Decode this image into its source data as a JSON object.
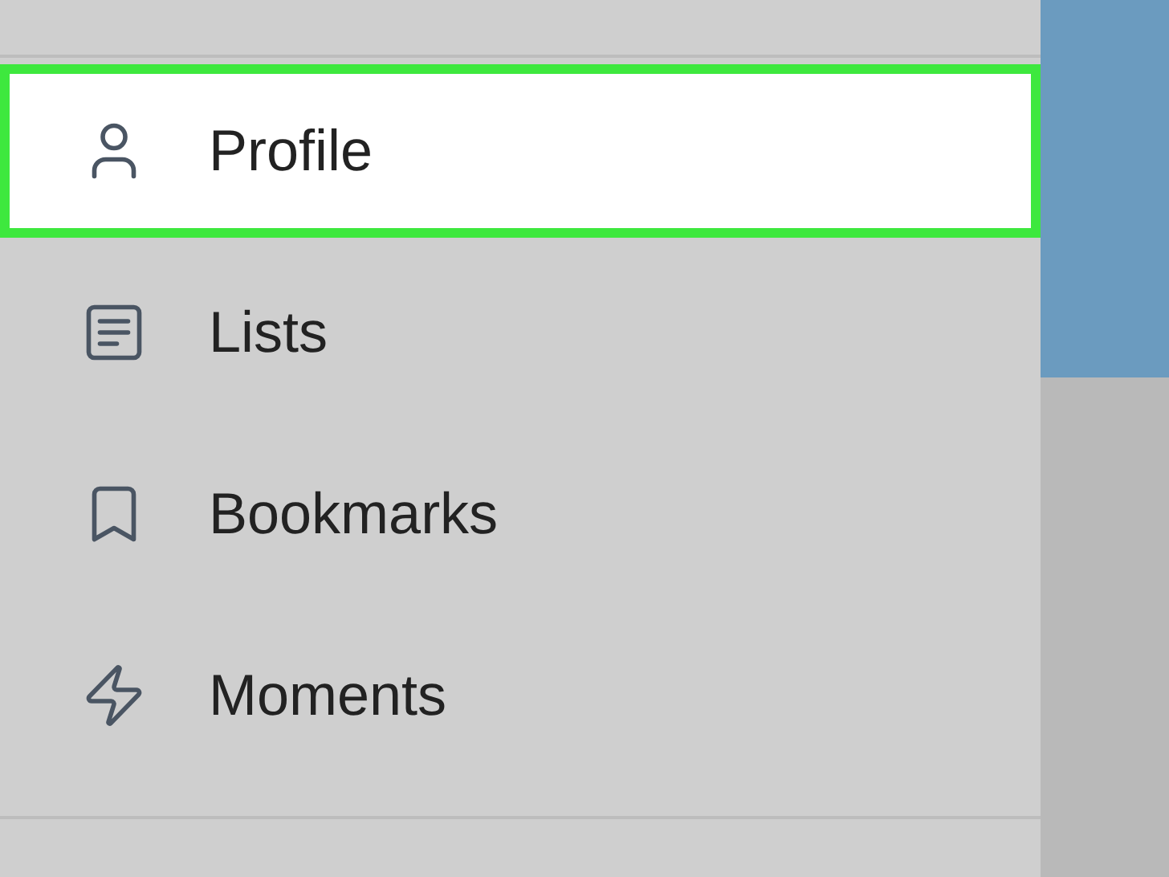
{
  "menu": {
    "items": [
      {
        "label": "Profile",
        "selected": true
      },
      {
        "label": "Lists",
        "selected": false
      },
      {
        "label": "Bookmarks",
        "selected": false
      },
      {
        "label": "Moments",
        "selected": false
      }
    ]
  }
}
